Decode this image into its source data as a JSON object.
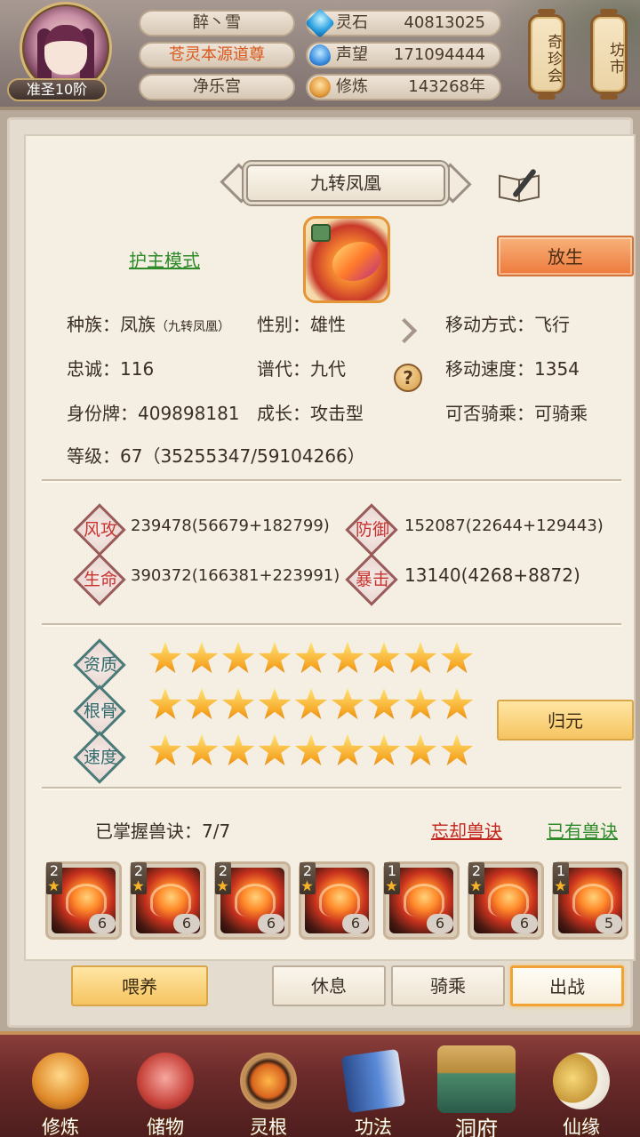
{
  "header": {
    "rank": "准圣10阶",
    "name": "醉丶雪",
    "title": "苍灵本源道尊",
    "sect": "净乐宫",
    "resources": [
      {
        "label": "灵石",
        "value": "40813025",
        "icon": "spirit-stone-icon"
      },
      {
        "label": "声望",
        "value": "171094444",
        "icon": "reputation-icon"
      },
      {
        "label": "修炼",
        "value": "143268年",
        "icon": "cultivation-icon"
      }
    ],
    "shops": [
      "奇珍会",
      "坊市"
    ]
  },
  "pet": {
    "name": "九转凤凰",
    "mode_link": "护主模式",
    "release_button": "放生",
    "attributes": {
      "race_label": "种族：",
      "race_value": "凤族",
      "race_sub": "（九转凤凰）",
      "gender_label": "性别：",
      "gender_value": "雄性",
      "move_type_label": "移动方式：",
      "move_type_value": "飞行",
      "loyalty_label": "忠诚：",
      "loyalty_value": "116",
      "generation_label": "谱代：",
      "generation_value": "九代",
      "move_speed_label": "移动速度：",
      "move_speed_value": "1354",
      "id_label": "身份牌：",
      "id_value": "409898181",
      "growth_label": "成长：",
      "growth_value": "攻击型",
      "rideable_label": "可否骑乘：",
      "rideable_value": "可骑乘",
      "level_label": "等级：",
      "level_value": "67",
      "exp_value": "（35255347/59104266）"
    },
    "stats": [
      {
        "label": "风攻",
        "value": "239478(56679+182799)",
        "color": "#c7322e"
      },
      {
        "label": "防御",
        "value": "152087(22644+129443)",
        "color": "#c7322e"
      },
      {
        "label": "生命",
        "value": "390372(166381+223991)",
        "color": "#c7322e"
      },
      {
        "label": "暴击",
        "value": "13140(4268+8872)",
        "color": "#c7322e"
      }
    ],
    "ratings": [
      {
        "label": "资质",
        "stars": 9
      },
      {
        "label": "根骨",
        "stars": 9
      },
      {
        "label": "速度",
        "stars": 9
      }
    ],
    "revert_button": "归元",
    "skills_label": "已掌握兽诀：7/7",
    "forget_link": "忘却兽诀",
    "owned_link": "已有兽诀",
    "skills": [
      {
        "tier": "2",
        "level": "6"
      },
      {
        "tier": "2",
        "level": "6"
      },
      {
        "tier": "2",
        "level": "6"
      },
      {
        "tier": "2",
        "level": "6"
      },
      {
        "tier": "1",
        "level": "6"
      },
      {
        "tier": "2",
        "level": "6"
      },
      {
        "tier": "1",
        "level": "5"
      }
    ]
  },
  "actions": {
    "feed": "喂养",
    "rest": "休息",
    "ride": "骑乘",
    "battle": "出战"
  },
  "nav": [
    "修炼",
    "储物",
    "灵根",
    "功法",
    "洞府",
    "仙缘"
  ]
}
